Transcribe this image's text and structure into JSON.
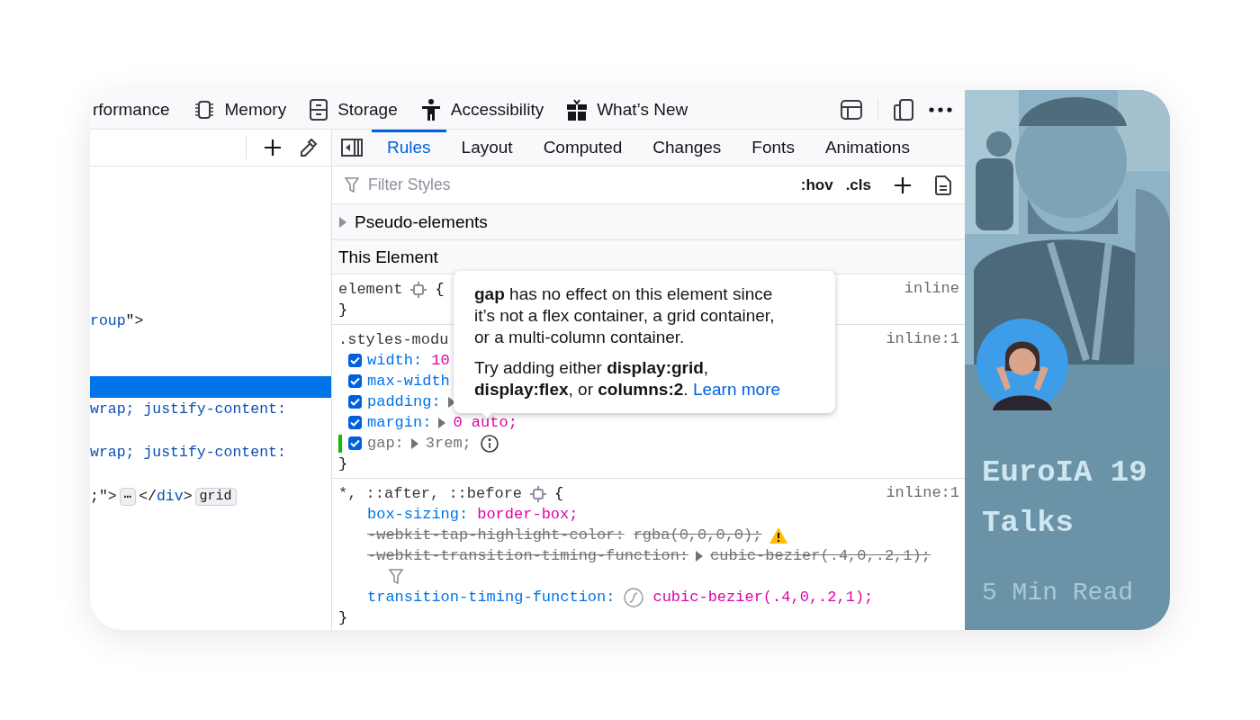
{
  "toolbar": {
    "tabs": [
      {
        "label": "rformance"
      },
      {
        "label": "Memory"
      },
      {
        "label": "Storage"
      },
      {
        "label": "Accessibility"
      },
      {
        "label": "What’s New"
      }
    ]
  },
  "markup": {
    "lines": [
      {
        "kind": "blank",
        "selected": false
      },
      {
        "kind": "blank",
        "selected": false
      },
      {
        "kind": "blank",
        "selected": false
      },
      {
        "kind": "blank",
        "selected": false
      },
      {
        "kind": "blank",
        "selected": false
      },
      {
        "kind": "blank",
        "selected": false
      },
      {
        "kind": "code",
        "selected": false,
        "segments": [
          {
            "kind": "value",
            "text": "roup"
          },
          {
            "kind": "punct",
            "text": "\">"
          }
        ]
      },
      {
        "kind": "blank",
        "selected": false
      },
      {
        "kind": "blank",
        "selected": false
      },
      {
        "kind": "blank",
        "selected": true
      },
      {
        "kind": "code",
        "selected": false,
        "segments": [
          {
            "kind": "value",
            "text": "wrap; justify-content:"
          }
        ]
      },
      {
        "kind": "blank",
        "selected": false
      },
      {
        "kind": "code",
        "selected": false,
        "segments": [
          {
            "kind": "value",
            "text": "wrap; justify-content:"
          }
        ]
      },
      {
        "kind": "blank",
        "selected": false
      },
      {
        "kind": "code",
        "selected": false,
        "segments": [
          {
            "kind": "punct",
            "text": ";\">"
          },
          {
            "kind": "more",
            "text": "⋯"
          },
          {
            "kind": "punct",
            "text": "</"
          },
          {
            "kind": "tag",
            "text": "div"
          },
          {
            "kind": "punct",
            "text": ">"
          },
          {
            "kind": "badge",
            "text": "grid"
          }
        ]
      }
    ]
  },
  "rules_panel": {
    "tabs": [
      {
        "label": "Rules",
        "selected": true
      },
      {
        "label": "Layout",
        "selected": false
      },
      {
        "label": "Computed",
        "selected": false
      },
      {
        "label": "Changes",
        "selected": false
      },
      {
        "label": "Fonts",
        "selected": false
      },
      {
        "label": "Animations",
        "selected": false
      }
    ],
    "filter": {
      "placeholder": "Filter Styles",
      "hov": ":hov",
      "cls": ".cls"
    },
    "pseudo_elements": {
      "label": "Pseudo-elements",
      "expanded": false
    },
    "section_title": "This Element",
    "rules": [
      {
        "selector": "element",
        "open_brace": "{",
        "close_brace": "}",
        "source": "inline"
      },
      {
        "kind": "checkable",
        "selector": ".styles-modu",
        "close_brace": "}",
        "source": "inline:1",
        "declarations": [
          {
            "name": "width:",
            "value": "10",
            "checked": true,
            "expandable": false,
            "inactive": false,
            "changed": false
          },
          {
            "name": "max-width",
            "checked": true,
            "expandable": false,
            "inactive": false,
            "changed": false
          },
          {
            "name": "padding:",
            "checked": true,
            "expandable": true,
            "inactive": false,
            "changed": false
          },
          {
            "name": "margin:",
            "value": "0 auto;",
            "checked": true,
            "expandable": true,
            "inactive": false,
            "changed": false
          },
          {
            "name": "gap:",
            "value": "3rem;",
            "checked": true,
            "expandable": true,
            "inactive": true,
            "changed": true,
            "info": true
          }
        ]
      },
      {
        "kind": "plain",
        "selector": "*, ::after, ::before",
        "open_brace": "{",
        "close_brace": "}",
        "source": "inline:1",
        "declarations": [
          {
            "name": "box-sizing:",
            "value": "border-box;",
            "overridden": false,
            "expandable": false
          },
          {
            "name": "-webkit-tap-highlight-color:",
            "value": "rgba(0,0,0,0);",
            "overridden": true,
            "expandable": false,
            "warning": true
          },
          {
            "name": "-webkit-transition-timing-function:",
            "value": "cubic-bezier(.4,0,.2,1);",
            "overridden": true,
            "expandable": true,
            "filter": true
          },
          {
            "name": "transition-timing-function:",
            "value": "cubic-bezier(.4,0,.2,1);",
            "overridden": false,
            "expandable": false,
            "swatch": true
          }
        ]
      }
    ],
    "tooltip": {
      "paragraphs": [
        "**gap** has no effect on this element since it’s not a flex container, a grid container, or a multi-column container.",
        "Try adding either **display:grid**, **display:flex**, or **columns:2**."
      ],
      "link": "Learn more"
    }
  },
  "article": {
    "title": "EuroIA 19 Talks",
    "meta": "5 Min Read"
  }
}
